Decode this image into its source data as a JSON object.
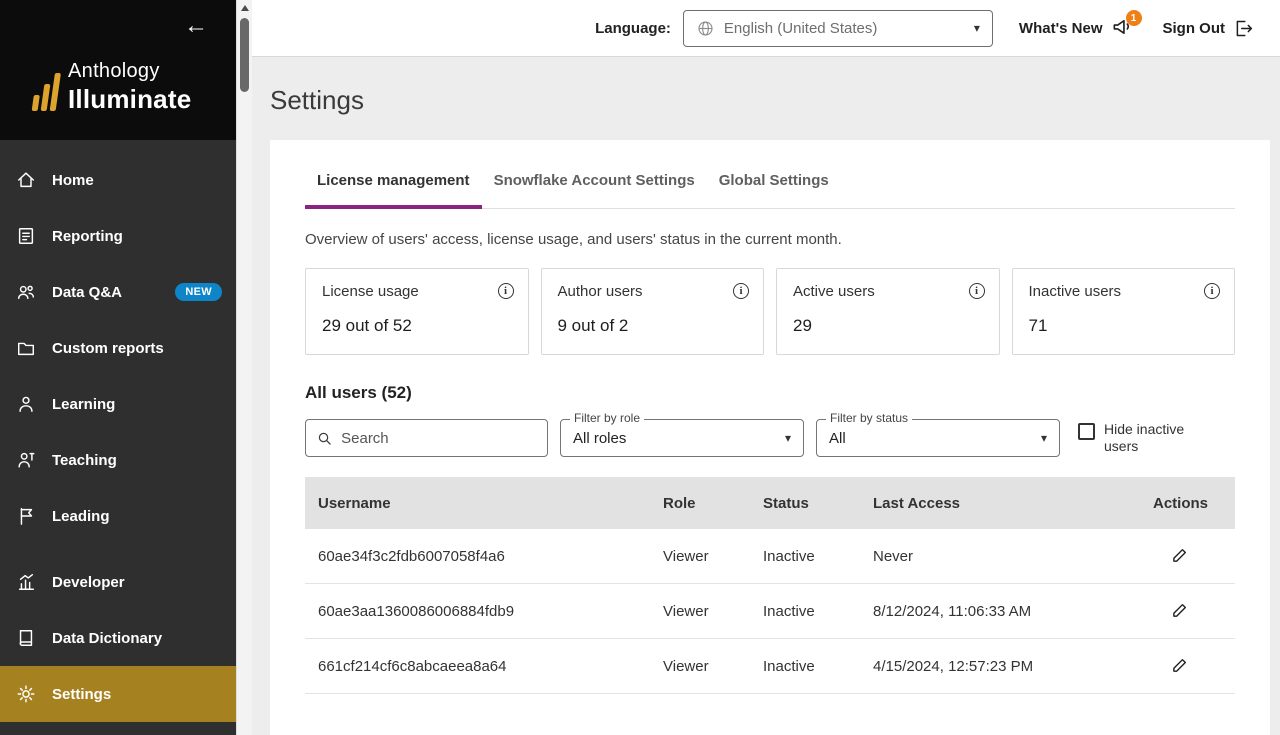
{
  "sidebar": {
    "brand_line1": "Anthology",
    "brand_line2": "Illuminate",
    "items": [
      {
        "label": "Home"
      },
      {
        "label": "Reporting"
      },
      {
        "label": "Data Q&A",
        "badge": "NEW"
      },
      {
        "label": "Custom reports"
      },
      {
        "label": "Learning"
      },
      {
        "label": "Teaching"
      },
      {
        "label": "Leading"
      },
      {
        "label": "Developer"
      },
      {
        "label": "Data Dictionary"
      },
      {
        "label": "Settings"
      }
    ]
  },
  "topbar": {
    "language_label": "Language:",
    "language_value": "English (United States)",
    "whats_new_label": "What's New",
    "whats_new_badge": "1",
    "sign_out_label": "Sign Out"
  },
  "page": {
    "title": "Settings"
  },
  "tabs": [
    {
      "label": "License management"
    },
    {
      "label": "Snowflake Account Settings"
    },
    {
      "label": "Global Settings"
    }
  ],
  "overview_text": "Overview of users' access, license usage, and users' status in the current month.",
  "stats": [
    {
      "label": "License usage",
      "value": "29 out of 52"
    },
    {
      "label": "Author users",
      "value": "9 out of 2"
    },
    {
      "label": "Active users",
      "value": "29"
    },
    {
      "label": "Inactive users",
      "value": "71"
    }
  ],
  "users_section": {
    "heading": "All users (52)",
    "search_placeholder": "Search",
    "filter_role_label": "Filter by role",
    "filter_role_value": "All roles",
    "filter_status_label": "Filter by status",
    "filter_status_value": "All",
    "hide_inactive_label": "Hide inactive users"
  },
  "table": {
    "headers": [
      "Username",
      "Role",
      "Status",
      "Last Access",
      "Actions"
    ],
    "rows": [
      {
        "username": "60ae34f3c2fdb6007058f4a6",
        "role": "Viewer",
        "status": "Inactive",
        "last_access": "Never"
      },
      {
        "username": "60ae3aa1360086006884fdb9",
        "role": "Viewer",
        "status": "Inactive",
        "last_access": "8/12/2024, 11:06:33 AM"
      },
      {
        "username": "661cf214cf6c8abcaeea8a64",
        "role": "Viewer",
        "status": "Inactive",
        "last_access": "4/15/2024, 12:57:23 PM"
      }
    ]
  },
  "colors": {
    "sidebar_active_gold": "#a6811f",
    "tab_active_purple": "#8a2482",
    "new_badge_blue": "#0d85c8",
    "whats_new_badge_orange": "#ef8018"
  }
}
